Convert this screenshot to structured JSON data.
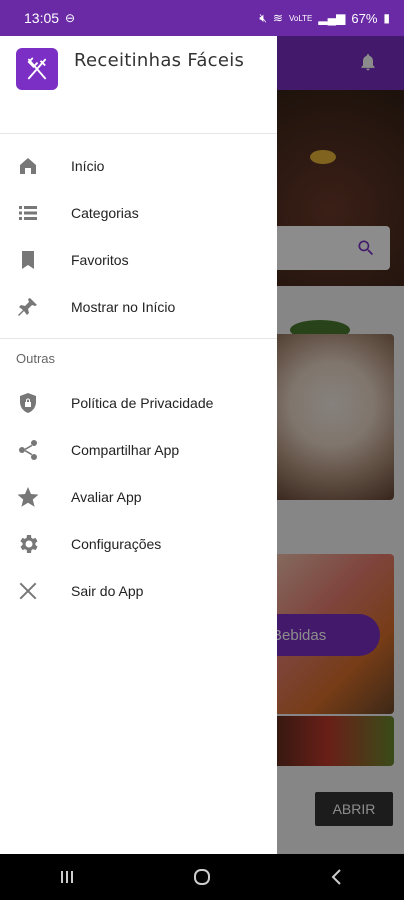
{
  "status_bar": {
    "time": "13:05",
    "battery": "67%",
    "network": "VoLTE"
  },
  "background": {
    "category_label": "Bebidas",
    "open_button": "ABRIR"
  },
  "drawer": {
    "app_title": "Receitinhas Fáceis",
    "menu_main": [
      {
        "label": "Início",
        "icon": "home-icon"
      },
      {
        "label": "Categorias",
        "icon": "list-icon"
      },
      {
        "label": "Favoritos",
        "icon": "bookmark-icon"
      },
      {
        "label": "Mostrar no Início",
        "icon": "pin-icon"
      }
    ],
    "section_other": "Outras",
    "menu_other": [
      {
        "label": "Política de Privacidade",
        "icon": "shield-icon"
      },
      {
        "label": "Compartilhar App",
        "icon": "share-icon"
      },
      {
        "label": "Avaliar App",
        "icon": "star-icon"
      },
      {
        "label": "Configurações",
        "icon": "gear-icon"
      },
      {
        "label": "Sair do App",
        "icon": "close-icon"
      }
    ]
  },
  "colors": {
    "primary": "#7b2fc4",
    "status_bar": "#6a2aa6",
    "icon_gray": "#777777"
  }
}
